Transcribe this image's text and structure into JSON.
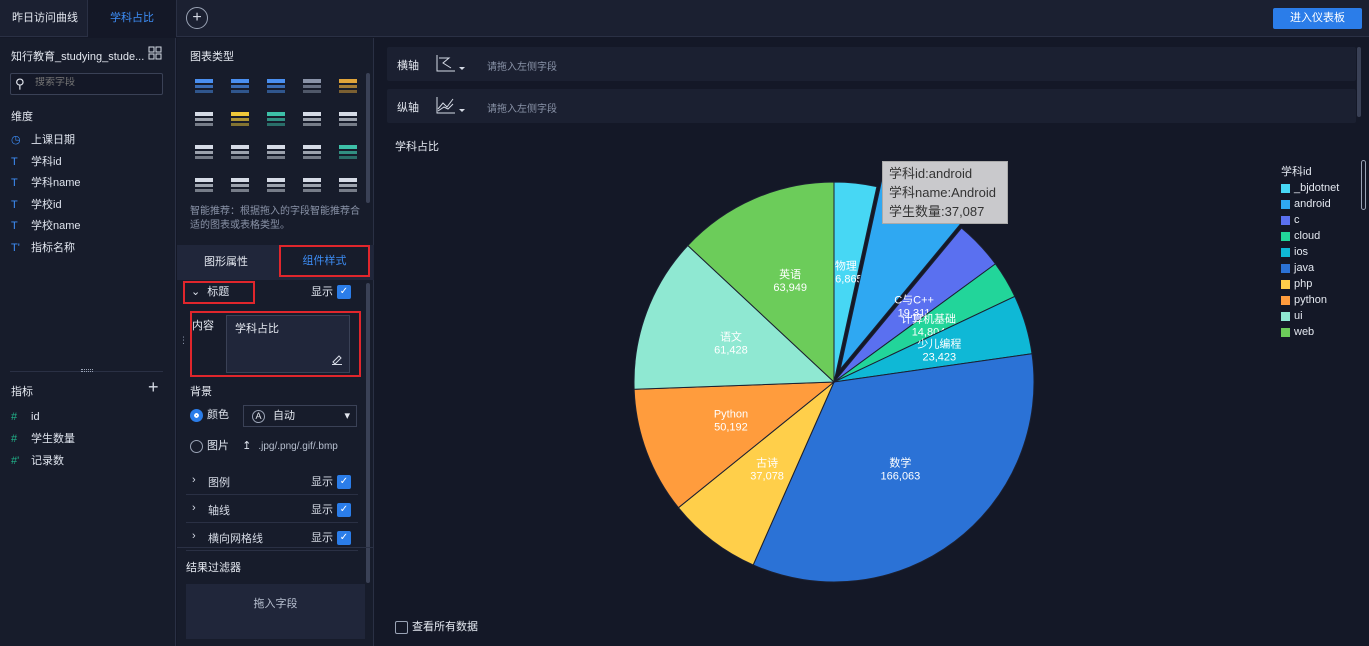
{
  "topbar": {
    "tabs": [
      {
        "label": "昨日访问曲线"
      },
      {
        "label": "学科占比"
      }
    ],
    "add_tab": "+",
    "enter_dashboard": "进入仪表板"
  },
  "left": {
    "dataset_title": "知行教育_studying_stude...",
    "search_placeholder": "搜索字段",
    "dimensions_label": "维度",
    "dimensions": [
      {
        "icon": "clock-icon",
        "glyph": "◷",
        "label": "上课日期"
      },
      {
        "icon": "text-type-icon",
        "glyph": "T",
        "label": "学科id"
      },
      {
        "icon": "text-type-icon",
        "glyph": "T",
        "label": "学科name"
      },
      {
        "icon": "text-type-icon",
        "glyph": "T",
        "label": "学校id"
      },
      {
        "icon": "text-type-icon",
        "glyph": "T",
        "label": "学校name"
      },
      {
        "icon": "calc-text-icon",
        "glyph": "T'",
        "label": "指标名称"
      }
    ],
    "measures_label": "指标",
    "measures": [
      {
        "icon": "number-type-icon",
        "glyph": "#",
        "label": "id"
      },
      {
        "icon": "number-type-icon",
        "glyph": "#",
        "label": "学生数量"
      },
      {
        "icon": "calc-number-icon",
        "glyph": "#'",
        "label": "记录数"
      }
    ]
  },
  "middle": {
    "chart_types_label": "图表类型",
    "smart_hint": "智能推荐：根据拖入的字段智能推荐合适的图表或表格类型。",
    "tabs": {
      "graph_props": "图形属性",
      "component_style": "组件样式"
    },
    "title_section": {
      "label": "标题",
      "show_label": "显示"
    },
    "content_label": "内容",
    "content_value": "学科占比",
    "background_label": "背景",
    "color_option": {
      "label": "颜色",
      "value": "自动"
    },
    "image_option": {
      "label": "图片",
      "formats": ".jpg/.png/.gif/.bmp"
    },
    "collapsibles": [
      {
        "label": "图例",
        "show_label": "显示"
      },
      {
        "label": "轴线",
        "show_label": "显示"
      },
      {
        "label": "横向网格线",
        "show_label": "显示"
      }
    ],
    "filter_label": "结果过滤器",
    "drop_field": "拖入字段"
  },
  "main": {
    "x_axis": {
      "label": "横轴",
      "placeholder": "请拖入左侧字段"
    },
    "y_axis": {
      "label": "纵轴",
      "placeholder": "请拖入左侧字段"
    },
    "chart_title": "学科占比",
    "view_all": "查看所有数据",
    "tooltip": {
      "line1": "学科id:android",
      "line2": "学科name:Android",
      "line3": "学生数量:37,087"
    }
  },
  "chart_data": {
    "type": "pie",
    "title": "学科占比",
    "legend_title": "学科id",
    "legend_position": "right",
    "legend": [
      {
        "label": "_bjdotnet",
        "color": "#47d7f4"
      },
      {
        "label": "android",
        "color": "#2fa8f2"
      },
      {
        "label": "c",
        "color": "#5a70f0"
      },
      {
        "label": "cloud",
        "color": "#22d59a"
      },
      {
        "label": "ios",
        "color": "#0fb8d6"
      },
      {
        "label": "java",
        "color": "#2b72d6"
      },
      {
        "label": "php",
        "color": "#ffcf4a"
      },
      {
        "label": "python",
        "color": "#ff9c3d"
      },
      {
        "label": "ui",
        "color": "#8fe8d2"
      },
      {
        "label": "web",
        "color": "#6ccc5a"
      }
    ],
    "slices": [
      {
        "name": "物理",
        "value": 16865,
        "value_label": "16,865",
        "color": "#47d7f4"
      },
      {
        "name": "",
        "value": 37087,
        "value_label": "",
        "color": "#2fa8f2"
      },
      {
        "name": "C与C++",
        "value": 19311,
        "value_label": "19,311",
        "color": "#5a70f0"
      },
      {
        "name": "计算机基础",
        "value": 14804,
        "value_label": "14,804",
        "color": "#22d59a"
      },
      {
        "name": "少儿编程",
        "value": 23423,
        "value_label": "23,423",
        "color": "#0fb8d6"
      },
      {
        "name": "数学",
        "value": 166063,
        "value_label": "166,063",
        "color": "#2b72d6"
      },
      {
        "name": "古诗",
        "value": 37078,
        "value_label": "37,078",
        "color": "#ffcf4a"
      },
      {
        "name": "Python",
        "value": 50192,
        "value_label": "50,192",
        "color": "#ff9c3d"
      },
      {
        "name": "语文",
        "value": 61428,
        "value_label": "61,428",
        "color": "#8fe8d2"
      },
      {
        "name": "英语",
        "value": 63949,
        "value_label": "63,949",
        "color": "#6ccc5a"
      }
    ]
  }
}
